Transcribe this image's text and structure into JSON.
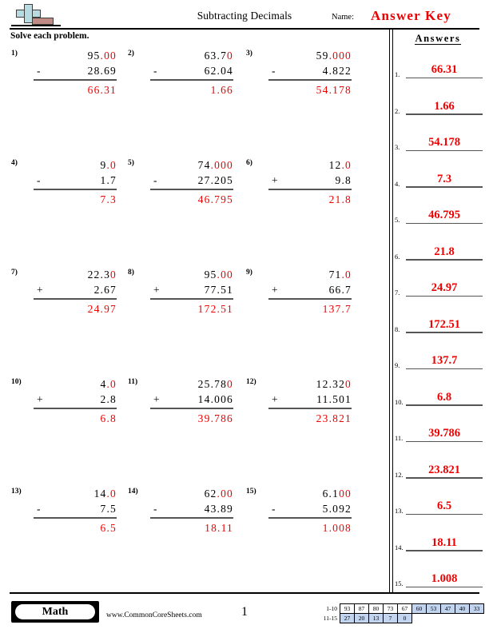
{
  "header": {
    "title": "Subtracting Decimals",
    "name_label": "Name:",
    "answer_key": "Answer Key",
    "logo_name": "commoncoresheets-logo"
  },
  "instruction": "Solve each problem.",
  "colors": {
    "answer_red": "#ee0000",
    "rule_gray": "#555555",
    "score_blue": "#c3d4ef",
    "logo_plus": "#b6dbe0",
    "logo_block": "#c08a85"
  },
  "problems": [
    {
      "number": "1)",
      "top_black": "95",
      "top_red": ".00",
      "operator": "-",
      "bottom": "28.69",
      "answer": "66.31"
    },
    {
      "number": "2)",
      "top_black": "63.7",
      "top_red": "0",
      "operator": "-",
      "bottom": "62.04",
      "answer": "1.66"
    },
    {
      "number": "3)",
      "top_black": "59",
      "top_red": ".000",
      "operator": "-",
      "bottom": "4.822",
      "answer": "54.178"
    },
    {
      "number": "4)",
      "top_black": "9",
      "top_red": ".0",
      "operator": "-",
      "bottom": "1.7",
      "answer": "7.3"
    },
    {
      "number": "5)",
      "top_black": "74",
      "top_red": ".000",
      "operator": "-",
      "bottom": "27.205",
      "answer": "46.795"
    },
    {
      "number": "6)",
      "top_black": "12",
      "top_red": ".0",
      "operator": "+",
      "bottom": "9.8",
      "answer": "21.8"
    },
    {
      "number": "7)",
      "top_black": "22.3",
      "top_red": "0",
      "operator": "+",
      "bottom": "2.67",
      "answer": "24.97"
    },
    {
      "number": "8)",
      "top_black": "95",
      "top_red": ".00",
      "operator": "+",
      "bottom": "77.51",
      "answer": "172.51"
    },
    {
      "number": "9)",
      "top_black": "71",
      "top_red": ".0",
      "operator": "+",
      "bottom": "66.7",
      "answer": "137.7"
    },
    {
      "number": "10)",
      "top_black": "4",
      "top_red": ".0",
      "operator": "+",
      "bottom": "2.8",
      "answer": "6.8"
    },
    {
      "number": "11)",
      "top_black": "25.78",
      "top_red": "0",
      "operator": "+",
      "bottom": "14.006",
      "answer": "39.786"
    },
    {
      "number": "12)",
      "top_black": "12.32",
      "top_red": "0",
      "operator": "+",
      "bottom": "11.501",
      "answer": "23.821"
    },
    {
      "number": "13)",
      "top_black": "14",
      "top_red": ".0",
      "operator": "-",
      "bottom": "7.5",
      "answer": "6.5"
    },
    {
      "number": "14)",
      "top_black": "62",
      "top_red": ".00",
      "operator": "-",
      "bottom": "43.89",
      "answer": "18.11"
    },
    {
      "number": "15)",
      "top_black": "6.1",
      "top_red": "00",
      "operator": "-",
      "bottom": "5.092",
      "answer": "1.008"
    }
  ],
  "answers_panel": {
    "heading": "Answers",
    "items": [
      {
        "index": "1.",
        "value": "66.31"
      },
      {
        "index": "2.",
        "value": "1.66"
      },
      {
        "index": "3.",
        "value": "54.178"
      },
      {
        "index": "4.",
        "value": "7.3"
      },
      {
        "index": "5.",
        "value": "46.795"
      },
      {
        "index": "6.",
        "value": "21.8"
      },
      {
        "index": "7.",
        "value": "24.97"
      },
      {
        "index": "8.",
        "value": "172.51"
      },
      {
        "index": "9.",
        "value": "137.7"
      },
      {
        "index": "10.",
        "value": "6.8"
      },
      {
        "index": "11.",
        "value": "39.786"
      },
      {
        "index": "12.",
        "value": "23.821"
      },
      {
        "index": "13.",
        "value": "6.5"
      },
      {
        "index": "14.",
        "value": "18.11"
      },
      {
        "index": "15.",
        "value": "1.008"
      }
    ]
  },
  "footer": {
    "badge_label": "Math",
    "website": "www.CommonCoreSheets.com",
    "page_number": "1",
    "score_table": {
      "rows": [
        {
          "label": "1-10",
          "cells": [
            {
              "value": "93",
              "highlight": false
            },
            {
              "value": "87",
              "highlight": false
            },
            {
              "value": "80",
              "highlight": false
            },
            {
              "value": "73",
              "highlight": false
            },
            {
              "value": "67",
              "highlight": false
            },
            {
              "value": "60",
              "highlight": true
            },
            {
              "value": "53",
              "highlight": true
            },
            {
              "value": "47",
              "highlight": true
            },
            {
              "value": "40",
              "highlight": true
            },
            {
              "value": "33",
              "highlight": true
            }
          ]
        },
        {
          "label": "11-15",
          "cells": [
            {
              "value": "27",
              "highlight": true
            },
            {
              "value": "20",
              "highlight": true
            },
            {
              "value": "13",
              "highlight": true
            },
            {
              "value": "7",
              "highlight": true
            },
            {
              "value": "0",
              "highlight": true
            }
          ]
        }
      ]
    }
  }
}
